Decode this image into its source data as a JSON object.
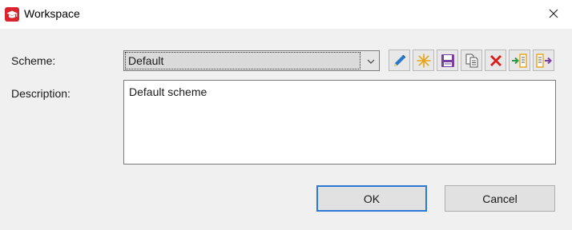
{
  "window": {
    "title": "Workspace",
    "app_icon": "graduation-cap-icon",
    "close_icon": "close-icon"
  },
  "scheme": {
    "label": "Scheme:",
    "selected": "Default",
    "dropdown_icon": "chevron-down-icon"
  },
  "toolbar": {
    "buttons": [
      {
        "name": "edit-scheme-button",
        "icon": "pencil-icon"
      },
      {
        "name": "new-scheme-button",
        "icon": "asterisk-icon"
      },
      {
        "name": "save-scheme-button",
        "icon": "floppy-disk-icon"
      },
      {
        "name": "copy-scheme-button",
        "icon": "copy-icon"
      },
      {
        "name": "delete-scheme-button",
        "icon": "delete-x-icon"
      },
      {
        "name": "import-scheme-button",
        "icon": "import-icon"
      },
      {
        "name": "export-scheme-button",
        "icon": "export-icon"
      }
    ]
  },
  "description": {
    "label": "Description:",
    "value": "Default scheme"
  },
  "buttons": {
    "ok_label": "OK",
    "cancel_label": "Cancel"
  },
  "colors": {
    "window_bg": "#f0f0f0",
    "titlebar_bg": "#ffffff",
    "focus_blue": "#2b79d6",
    "app_icon_red": "#d9232d"
  }
}
